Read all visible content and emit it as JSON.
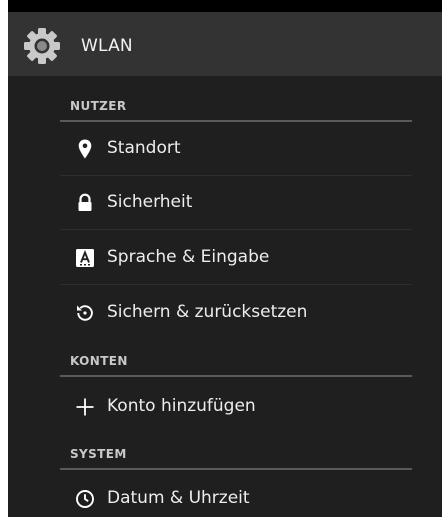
{
  "app": {
    "title": "WLAN",
    "icon": "settings-gear-icon"
  },
  "sections": [
    {
      "header": "NUTZER",
      "items": [
        {
          "label": "Standort",
          "icon": "location-pin-icon"
        },
        {
          "label": "Sicherheit",
          "icon": "lock-icon"
        },
        {
          "label": "Sprache & Eingabe",
          "icon": "keyboard-a-icon"
        },
        {
          "label": "Sichern & zurücksetzen",
          "icon": "restore-icon"
        }
      ]
    },
    {
      "header": "KONTEN",
      "items": [
        {
          "label": "Konto hinzufügen",
          "icon": "plus-icon"
        }
      ]
    },
    {
      "header": "SYSTEM",
      "items": [
        {
          "label": "Datum & Uhrzeit",
          "icon": "clock-icon"
        }
      ]
    }
  ],
  "colors": {
    "background": "#1f1f1f",
    "action_bar": "#333333",
    "divider": "#5a5a5a",
    "text": "#ededed"
  }
}
